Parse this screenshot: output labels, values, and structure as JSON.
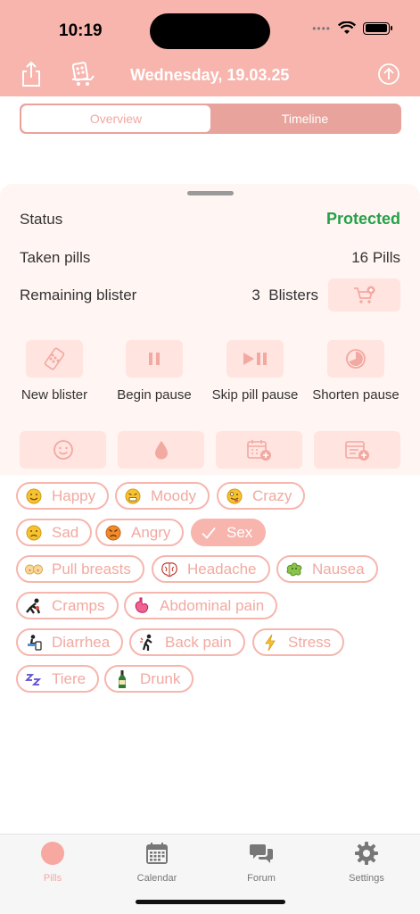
{
  "status_bar": {
    "time": "10:19"
  },
  "header": {
    "date": "Wednesday, 19.03.25",
    "icons": [
      "share-icon",
      "blister-cart-icon",
      "arrow-up-circle-icon"
    ]
  },
  "segments": {
    "overview": "Overview",
    "timeline": "Timeline",
    "selected": "Overview"
  },
  "summary": {
    "status_label": "Status",
    "status_value": "Protected",
    "taken_label": "Taken pills",
    "taken_value": "16 Pills",
    "remaining_label": "Remaining blister",
    "remaining_value": "3  Blisters"
  },
  "actions": [
    {
      "label": "New blister",
      "icon": "blister-icon"
    },
    {
      "label": "Begin pause",
      "icon": "pause-icon"
    },
    {
      "label": "Skip pill pause",
      "icon": "play-pause-icon"
    },
    {
      "label": "Shorten pause",
      "icon": "pie-clock-icon"
    }
  ],
  "tools": [
    "smiley-icon",
    "drop-icon",
    "calendar-add-icon",
    "note-add-icon"
  ],
  "symptoms": [
    {
      "label": "Happy",
      "icon": "happy-face-icon",
      "selected": false
    },
    {
      "label": "Moody",
      "icon": "moody-face-icon",
      "selected": false
    },
    {
      "label": "Crazy",
      "icon": "crazy-face-icon",
      "selected": false
    },
    {
      "label": "Sad",
      "icon": "sad-face-icon",
      "selected": false
    },
    {
      "label": "Angry",
      "icon": "angry-face-icon",
      "selected": false
    },
    {
      "label": "Sex",
      "icon": "checkmark-icon",
      "selected": true
    },
    {
      "label": "Pull breasts",
      "icon": "breasts-icon",
      "selected": false
    },
    {
      "label": "Headache",
      "icon": "brain-icon",
      "selected": false
    },
    {
      "label": "Nausea",
      "icon": "nausea-icon",
      "selected": false
    },
    {
      "label": "Cramps",
      "icon": "cramps-icon",
      "selected": false
    },
    {
      "label": "Abdominal pain",
      "icon": "stomach-icon",
      "selected": false
    },
    {
      "label": "Diarrhea",
      "icon": "toilet-icon",
      "selected": false
    },
    {
      "label": "Back pain",
      "icon": "back-pain-icon",
      "selected": false
    },
    {
      "label": "Stress",
      "icon": "lightning-icon",
      "selected": false
    },
    {
      "label": "Tiere",
      "icon": "zzz-icon",
      "selected": false
    },
    {
      "label": "Drunk",
      "icon": "bottle-icon",
      "selected": false
    }
  ],
  "tabbar": [
    {
      "label": "Pills",
      "icon": "pill-circle-icon",
      "active": true
    },
    {
      "label": "Calendar",
      "icon": "calendar-icon",
      "active": false
    },
    {
      "label": "Forum",
      "icon": "chat-bubbles-icon",
      "active": false
    },
    {
      "label": "Settings",
      "icon": "gear-icon",
      "active": false
    }
  ],
  "colors": {
    "header": "#f7b5ad",
    "accent_text": "#f2a9a1",
    "protected": "#24a148",
    "button_bg": "#ffe4e0",
    "sheet_bg": "#fff5f3"
  }
}
